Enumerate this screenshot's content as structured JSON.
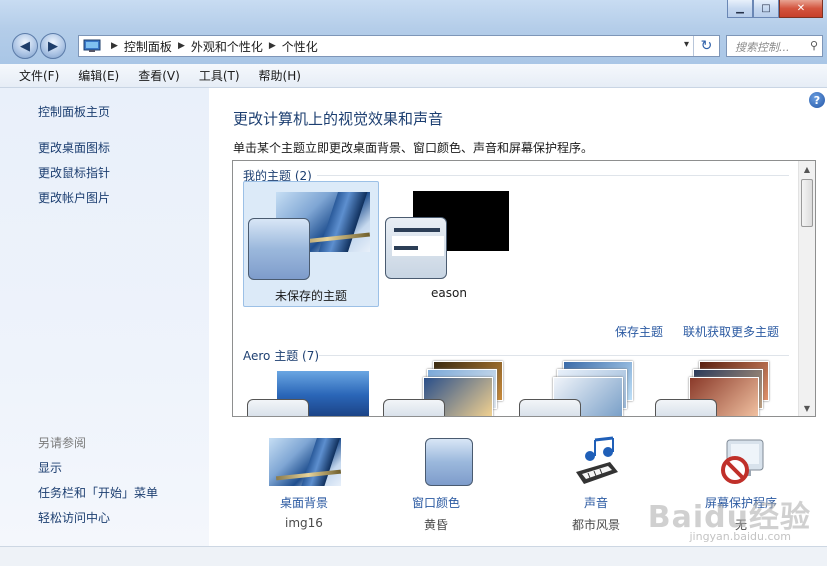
{
  "window": {
    "minimize": "▁",
    "maximize": "□",
    "close": "✕",
    "back": "◀",
    "forward": "▶"
  },
  "address": {
    "crumbs": [
      "控制面板",
      "外观和个性化",
      "个性化"
    ],
    "dropdown": "▾",
    "refresh": "↻"
  },
  "search": {
    "placeholder": "搜索控制...",
    "icon": "⚲"
  },
  "menu": [
    "文件(F)",
    "编辑(E)",
    "查看(V)",
    "工具(T)",
    "帮助(H)"
  ],
  "left": {
    "home": "控制面板主页",
    "links": [
      "更改桌面图标",
      "更改鼠标指针",
      "更改帐户图片"
    ],
    "see_also": "另请参阅",
    "see_links": [
      "显示",
      "任务栏和「开始」菜单",
      "轻松访问中心"
    ]
  },
  "main": {
    "help": "?",
    "title": "更改计算机上的视觉效果和声音",
    "description": "单击某个主题立即更改桌面背景、窗口颜色、声音和屏幕保护程序。",
    "my_themes": "我的主题 (2)",
    "themes": [
      "未保存的主题",
      "eason"
    ],
    "save_theme": "保存主题",
    "get_more": "联机获取更多主题",
    "aero_themes": "Aero 主题 (7)"
  },
  "quick": [
    {
      "label": "桌面背景",
      "value": "img16",
      "icon": "desktop-background-icon"
    },
    {
      "label": "窗口颜色",
      "value": "黄昏",
      "icon": "window-color-icon"
    },
    {
      "label": "声音",
      "value": "都市风景",
      "icon": "sound-icon"
    },
    {
      "label": "屏幕保护程序",
      "value": "无",
      "icon": "screensaver-icon"
    }
  ],
  "watermark": {
    "brand": "Baidu经验",
    "url": "jingyan.baidu.com"
  }
}
